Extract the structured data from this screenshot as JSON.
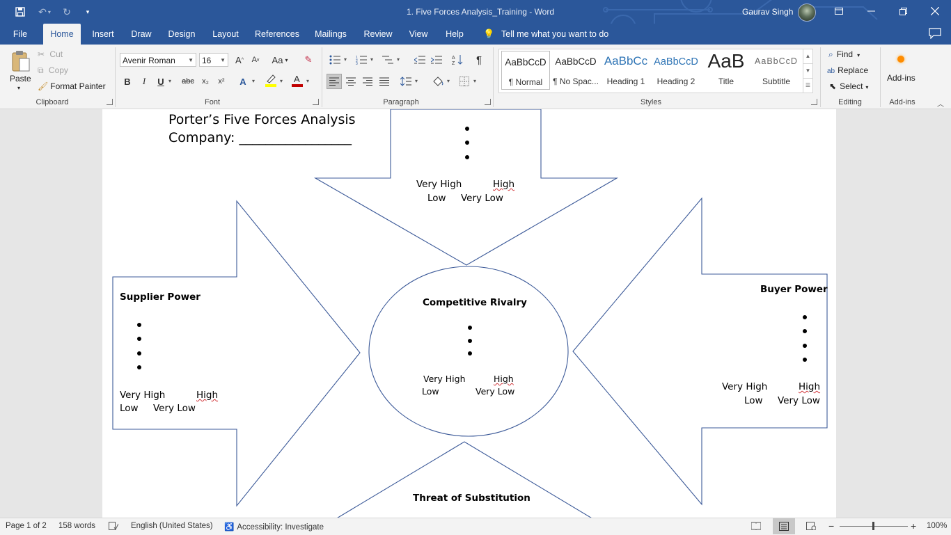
{
  "titlebar": {
    "document_title": "1. Five Forces Analysis_Training  -  Word",
    "user_name": "Gaurav Singh",
    "save_icon": "save-icon",
    "undo_icon": "undo-icon",
    "redo_icon": "redo-icon",
    "customize_icon": "customize-qat-icon"
  },
  "tabs": [
    "File",
    "Home",
    "Insert",
    "Draw",
    "Design",
    "Layout",
    "References",
    "Mailings",
    "Review",
    "View",
    "Help"
  ],
  "active_tab": "Home",
  "tell_me": "Tell me what you want to do",
  "ribbon": {
    "clipboard": {
      "paste": "Paste",
      "cut": "Cut",
      "copy": "Copy",
      "format_painter": "Format Painter",
      "label": "Clipboard"
    },
    "font": {
      "font_name": "Avenir Roman",
      "font_size": "16",
      "label": "Font",
      "bold": "B",
      "italic": "I",
      "underline": "U",
      "strike": "abc",
      "subscript": "x₂",
      "superscript": "x²",
      "change_case": "Aa",
      "grow": "A",
      "shrink": "A"
    },
    "paragraph": {
      "label": "Paragraph"
    },
    "styles": {
      "label": "Styles",
      "items": [
        {
          "preview": "AaBbCcD",
          "name": "¶ Normal"
        },
        {
          "preview": "AaBbCcD",
          "name": "¶ No Spac..."
        },
        {
          "preview": "AaBbCc",
          "name": "Heading 1"
        },
        {
          "preview": "AaBbCcD",
          "name": "Heading 2"
        },
        {
          "preview": "AaB",
          "name": "Title"
        },
        {
          "preview": "AaBbCcD",
          "name": "Subtitle"
        }
      ]
    },
    "editing": {
      "label": "Editing",
      "find": "Find",
      "replace": "Replace",
      "select": "Select"
    },
    "addins": {
      "label": "Add-ins",
      "button": "Add-ins"
    }
  },
  "document": {
    "title": "Porter’s Five Forces Analysis",
    "company": "Company: _________________",
    "top_force": {
      "rating_row1_a": "Very High",
      "rating_row1_b": "High",
      "rating_row2_a": "Low",
      "rating_row2_b": "Very Low"
    },
    "supplier": {
      "heading": "Supplier Power",
      "rating_row1_a": "Very High",
      "rating_row1_b": "High",
      "rating_row2_a": "Low",
      "rating_row2_b": "Very Low"
    },
    "rivalry": {
      "heading": "Competitive Rivalry",
      "rating_row1_a": "Very High",
      "rating_row1_b": "High",
      "rating_row2_a": "Low",
      "rating_row2_b": "Very Low"
    },
    "buyer": {
      "heading": "Buyer Power",
      "rating_row1_a": "Very High",
      "rating_row1_b": "High",
      "rating_row2_a": "Low",
      "rating_row2_b": "Very Low"
    },
    "substitution": {
      "heading": "Threat of Substitution"
    },
    "shape_stroke": "#3b5998"
  },
  "statusbar": {
    "page": "Page 1 of 2",
    "words": "158 words",
    "language": "English (United States)",
    "accessibility": "Accessibility: Investigate",
    "zoom": "100%"
  },
  "colors": {
    "brand": "#2b579a",
    "ribbon": "#f3f3f3",
    "font_color_bar": "#c00000",
    "highlight_bar": "#ffff00",
    "addins_dot": "#ff8c00"
  }
}
